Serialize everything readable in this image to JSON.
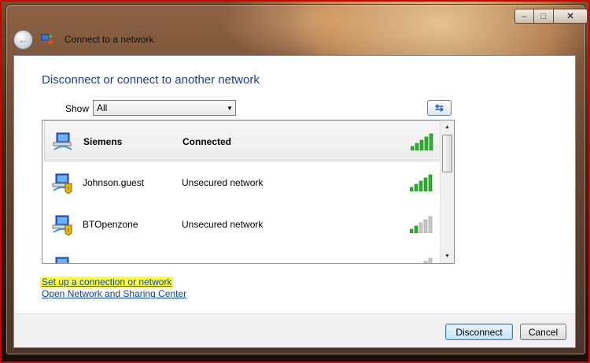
{
  "window": {
    "title": "Connect to a network",
    "minimize_glyph": "–",
    "maximize_glyph": "□",
    "close_glyph": "✕",
    "back_glyph": "←"
  },
  "content": {
    "heading": "Disconnect or connect to another network",
    "show_label": "Show",
    "show_select_value": "All",
    "refresh_glyph": "⇆"
  },
  "networks": [
    {
      "name": "Siemens",
      "status": "Connected",
      "selected": true,
      "signal_bars": 5
    },
    {
      "name": "Johnson.guest",
      "status": "Unsecured network",
      "selected": false,
      "signal_bars": 5
    },
    {
      "name": "BTOpenzone",
      "status": "Unsecured network",
      "selected": false,
      "signal_bars": 2
    },
    {
      "name": "",
      "status": "",
      "selected": false,
      "signal_bars": 1
    }
  ],
  "links": {
    "setup": "Set up a connection or network",
    "sharing_center": "Open Network and Sharing Center"
  },
  "buttons": {
    "disconnect": "Disconnect",
    "cancel": "Cancel"
  },
  "colors": {
    "heading": "#1e3e8e",
    "link": "#0645ad",
    "highlight": "#ffff3c",
    "signal_on": "#2db02d",
    "signal_off": "#c8c8c8"
  },
  "icons": {
    "back": "back-arrow-icon",
    "title": "network-connect-icon",
    "network": "wireless-network-icon",
    "refresh": "refresh-icon"
  }
}
